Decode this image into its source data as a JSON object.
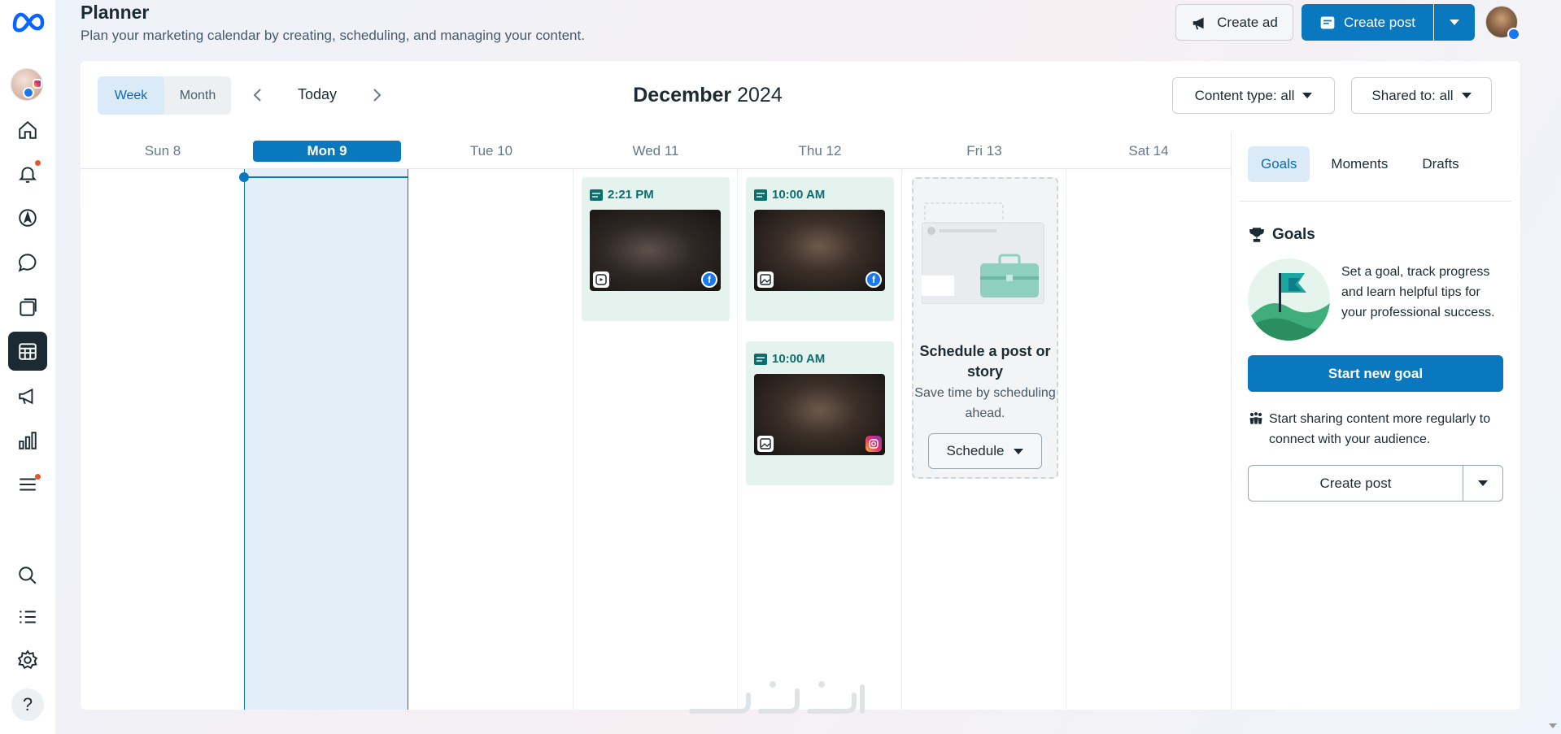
{
  "header": {
    "title": "Planner",
    "subtitle": "Plan your marketing calendar by creating, scheduling, and managing your content.",
    "create_ad_label": "Create ad",
    "create_post_label": "Create post"
  },
  "rail": {
    "items": [
      {
        "icon": "home-icon"
      },
      {
        "icon": "bell-icon",
        "badge": true
      },
      {
        "icon": "compass-icon"
      },
      {
        "icon": "chat-icon"
      },
      {
        "icon": "pages-icon"
      },
      {
        "icon": "planner-icon",
        "active": true
      },
      {
        "icon": "megaphone-icon"
      },
      {
        "icon": "insights-icon"
      },
      {
        "icon": "menu-icon",
        "badge": true
      },
      {
        "icon": "search-icon"
      },
      {
        "icon": "list-icon"
      },
      {
        "icon": "settings-icon"
      },
      {
        "icon": "help-icon"
      }
    ]
  },
  "toolbar": {
    "view_week": "Week",
    "view_month": "Month",
    "active_view": "Week",
    "today_label": "Today",
    "month_name": "December",
    "year": "2024",
    "content_type_filter": "Content type: all",
    "shared_to_filter": "Shared to: all"
  },
  "days": [
    {
      "label": "Sun 8"
    },
    {
      "label": "Mon 9",
      "today": true
    },
    {
      "label": "Tue 10"
    },
    {
      "label": "Wed 11"
    },
    {
      "label": "Thu 12"
    },
    {
      "label": "Fri 13"
    },
    {
      "label": "Sat 14"
    }
  ],
  "posts": {
    "wed": {
      "time": "2:21 PM",
      "platform": "facebook",
      "format": "reel"
    },
    "thu_1": {
      "time": "10:00 AM",
      "platform": "facebook",
      "format": "photo"
    },
    "thu_2": {
      "time": "10:00 AM",
      "platform": "instagram",
      "format": "photo"
    }
  },
  "schedule_card": {
    "title": "Schedule a post or story",
    "text": "Save time by scheduling ahead.",
    "button": "Schedule"
  },
  "right_panel": {
    "tabs": [
      "Goals",
      "Moments",
      "Drafts"
    ],
    "active_tab": "Goals",
    "goals_title": "Goals",
    "goals_text": "Set a goal, track progress and learn helpful tips for your professional success.",
    "start_goal_button": "Start new goal",
    "share_tip": "Start sharing content more regularly to connect with your audience.",
    "create_post_button": "Create post"
  },
  "colors": {
    "primary": "#0a78be",
    "post_bg": "#e4f3ee",
    "today_band": "#e3eef8",
    "text": "#1c2b33"
  }
}
